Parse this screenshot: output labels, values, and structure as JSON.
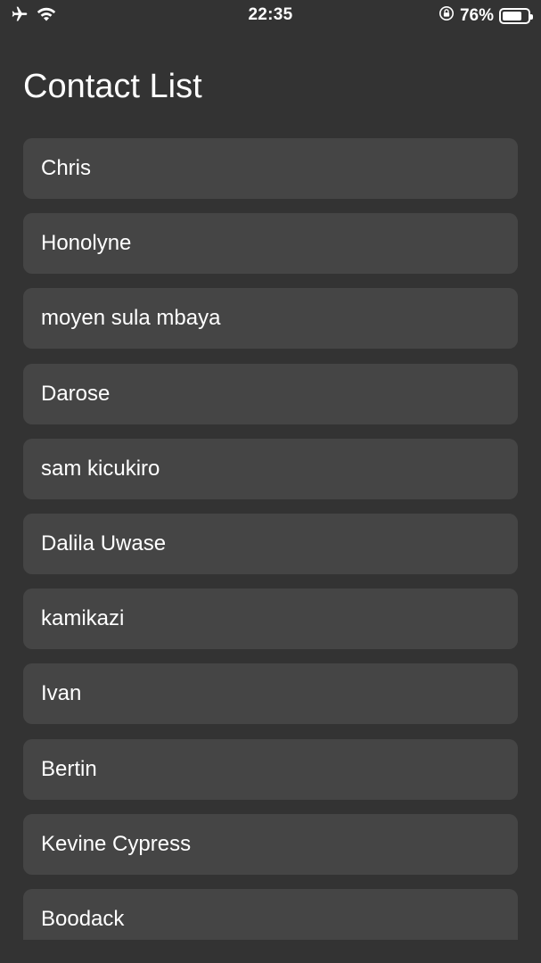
{
  "status_bar": {
    "time": "22:35",
    "battery_percent_label": "76%",
    "battery_level": 0.76,
    "icons": [
      "airplane-icon",
      "wifi-icon",
      "orientation-lock-icon",
      "battery-icon"
    ]
  },
  "header": {
    "title": "Contact List"
  },
  "contacts": [
    {
      "name": "Chris"
    },
    {
      "name": "Honolyne"
    },
    {
      "name": "moyen sula mbaya"
    },
    {
      "name": "Darose"
    },
    {
      "name": "sam kicukiro"
    },
    {
      "name": "Dalila Uwase"
    },
    {
      "name": "kamikazi"
    },
    {
      "name": "Ivan"
    },
    {
      "name": "Bertin"
    },
    {
      "name": "Kevine Cypress"
    },
    {
      "name": "Boodack"
    }
  ],
  "colors": {
    "background": "#333333",
    "item_background": "#454545",
    "text": "#ffffff"
  }
}
